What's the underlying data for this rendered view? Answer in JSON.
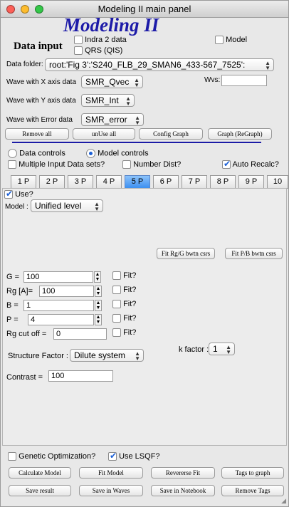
{
  "window": {
    "title": "Modeling II main panel"
  },
  "header": {
    "big_title": "Modeling II"
  },
  "data_input": {
    "label": "Data input",
    "indra2": "Indra 2 data",
    "qrs": "QRS (QIS)",
    "model": "Model",
    "folder_label": "Data folder:",
    "folder_value": "root:'Fig 3':'S240_FLB_29_SMAN6_433-567_7525':",
    "wvs_label": "Wvs:",
    "wvs_value": "",
    "x_label": "Wave with X axis data",
    "x_value": "SMR_Qvec",
    "y_label": "Wave with Y axis data",
    "y_value": "SMR_Int",
    "err_label": "Wave with Error data",
    "err_value": "SMR_error",
    "remove_all": "Remove all",
    "unuse_all": "unUse all",
    "config_graph": "Config Graph",
    "graph_regraph": "Graph (ReGraph)"
  },
  "controls": {
    "data_controls": "Data controls",
    "model_controls": "Model controls",
    "multiple_input": "Multiple Input Data sets?",
    "number_dist": "Number Dist?",
    "auto_recalc": "Auto Recalc?",
    "auto_recalc_checked": true
  },
  "tabs": [
    "1 P",
    "2 P",
    "3 P",
    "4 P",
    "5 P",
    "6 P",
    "7 P",
    "8 P",
    "9 P",
    "10"
  ],
  "panel": {
    "use_label": "Use?",
    "model_label": "Model :",
    "model_value": "Unified level",
    "fit_rg_btn": "Fit Rg/G bwtn csrs",
    "fit_pb_btn": "Fit P/B bwtn csrs",
    "params": [
      {
        "name": "G =",
        "value": "100",
        "fit": "Fit?"
      },
      {
        "name": "Rg [A]=",
        "value": "100",
        "fit": "Fit?"
      },
      {
        "name": "B =",
        "value": "1",
        "fit": "Fit?"
      },
      {
        "name": "P   =",
        "value": "4",
        "fit": "Fit?"
      },
      {
        "name": "Rg cut off =",
        "value": "0",
        "fit": "Fit?"
      }
    ],
    "structure_label": "Structure Factor :",
    "structure_value": "Dilute system",
    "kfactor_label": "k factor :",
    "kfactor_value": "1",
    "contrast_label": "Contrast =",
    "contrast_value": "100"
  },
  "bottom": {
    "genetic": "Genetic Optimization?",
    "lsqf": "Use LSQF?",
    "lsqf_checked": true,
    "calc_model": "Calculate Model",
    "fit_model": "Fit Model",
    "reverse_fit": "Revererse Fit",
    "tags_to_graph": "Tags to graph",
    "save_result": "Save result",
    "save_waves": "Save in Waves",
    "save_notebook": "Save in Notebook",
    "remove_tags": "Remove Tags"
  },
  "colors": {
    "title_blue": "#1d1ba8",
    "divider_blue": "#1b1ba6",
    "tab_active": "#3d8ff0",
    "check_blue": "#1a5fd6"
  }
}
